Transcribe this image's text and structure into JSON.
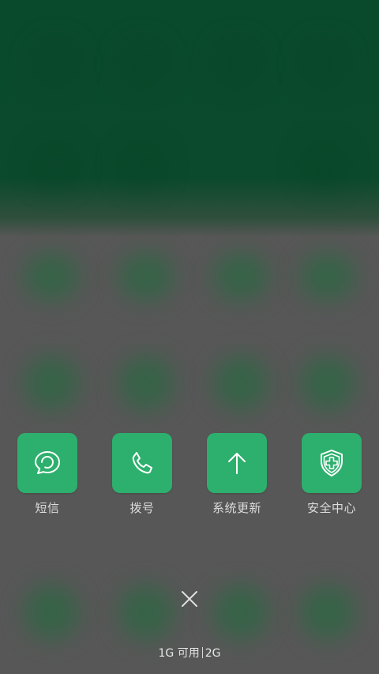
{
  "apps": [
    {
      "label": "短信",
      "icon": "message-bubble-icon"
    },
    {
      "label": "拨号",
      "icon": "phone-icon"
    },
    {
      "label": "系统更新",
      "icon": "arrow-up-icon"
    },
    {
      "label": "安全中心",
      "icon": "shield-plus-icon"
    }
  ],
  "close": {
    "icon": "close-icon"
  },
  "storage": {
    "used": "1G 可用",
    "total": "2G"
  },
  "colors": {
    "accent": "#2db06d",
    "top_bg": "#0a4a2c",
    "bottom_bg": "#575757"
  }
}
